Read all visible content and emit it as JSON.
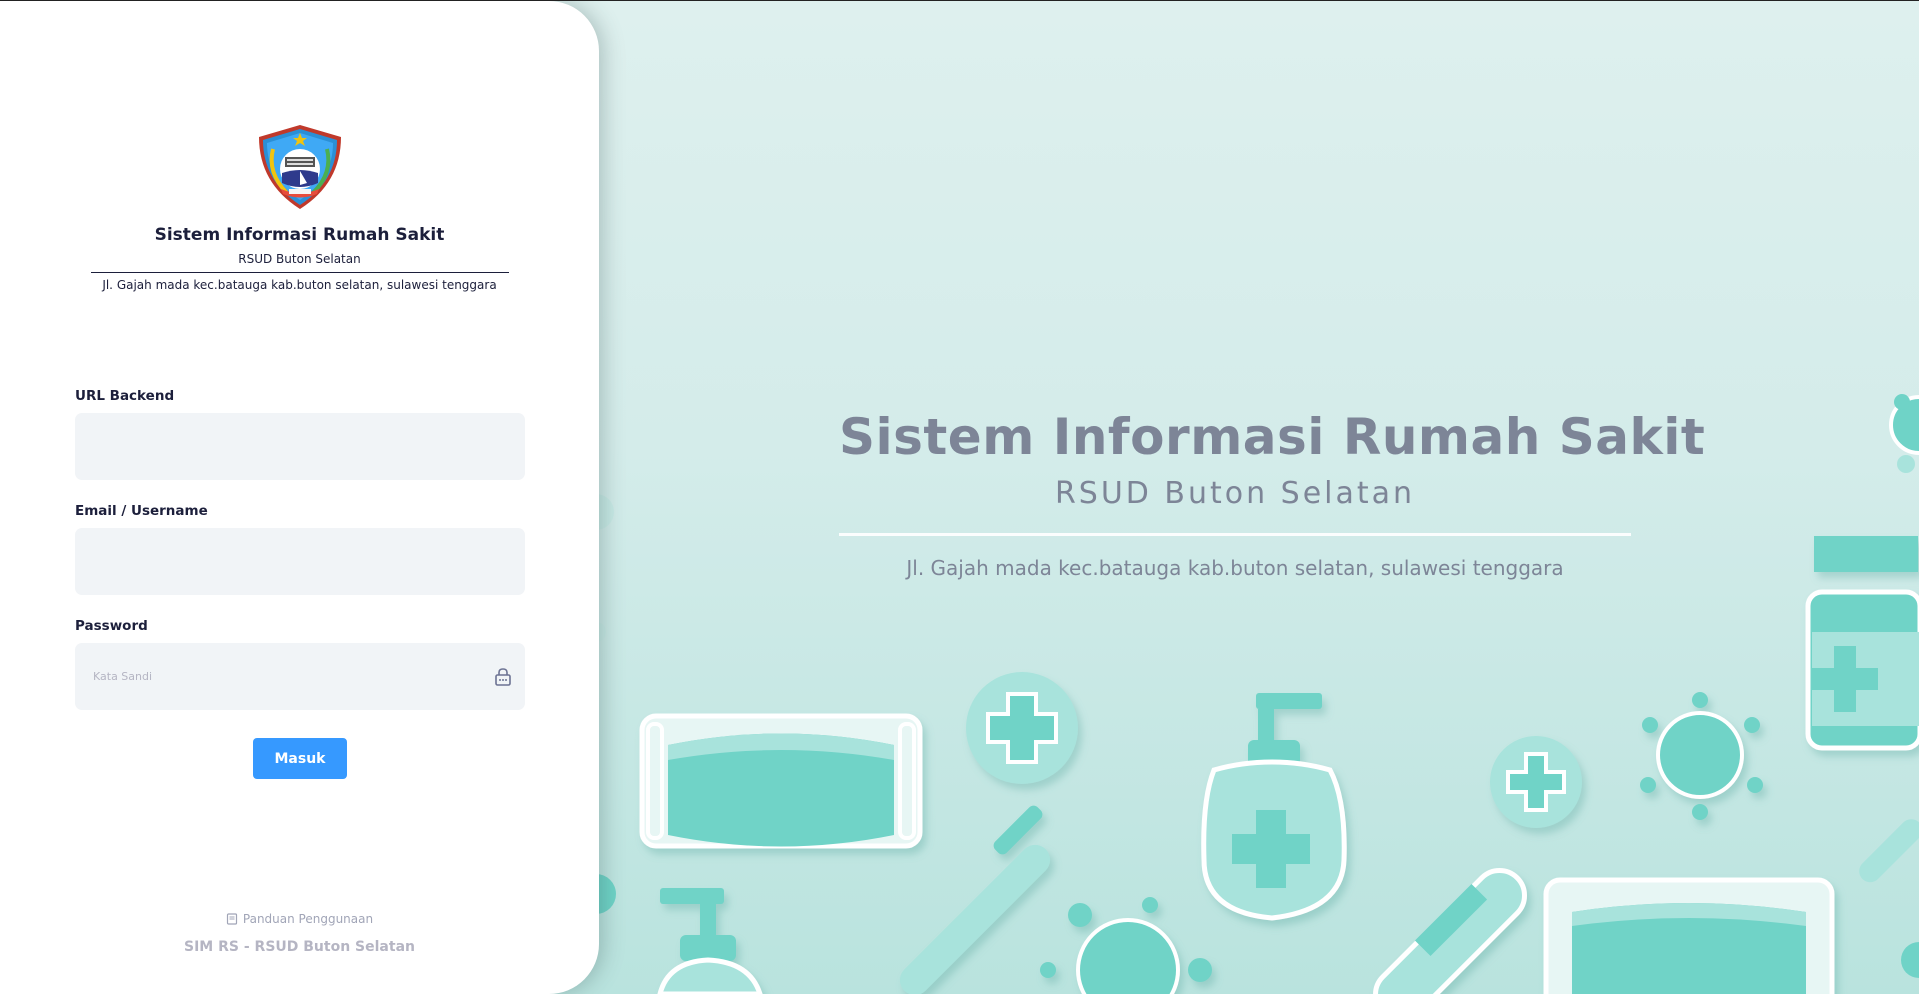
{
  "brand": {
    "title": "Sistem Informasi Rumah Sakit",
    "subtitle": "RSUD Buton Selatan",
    "address": "Jl. Gajah mada kec.batauga kab.buton selatan, sulawesi tenggara",
    "logo_icon": "buton-selatan-regency-crest"
  },
  "form": {
    "url_label": "URL Backend",
    "url_value": "",
    "url_placeholder": "",
    "email_label": "Email / Username",
    "email_value": "",
    "email_placeholder": "",
    "password_label": "Password",
    "password_value": "",
    "password_placeholder": "Kata Sandi",
    "password_icon": "lock-icon",
    "submit_label": "Masuk"
  },
  "footer": {
    "guide_label": "Panduan Penggunaan",
    "guide_icon": "book-icon",
    "copyright": "SIM RS - RSUD Buton Selatan"
  },
  "hero": {
    "title": "Sistem Informasi Rumah Sakit",
    "subtitle": "RSUD Buton Selatan",
    "address": "Jl. Gajah mada kec.batauga kab.buton selatan, sulawesi tenggara"
  },
  "colors": {
    "primary": "#3699ff",
    "background_teal": "#dbefed",
    "illustration_teal": "#6fd3c7",
    "text_dark": "#1c1f3b",
    "hero_text": "#7d8597"
  }
}
